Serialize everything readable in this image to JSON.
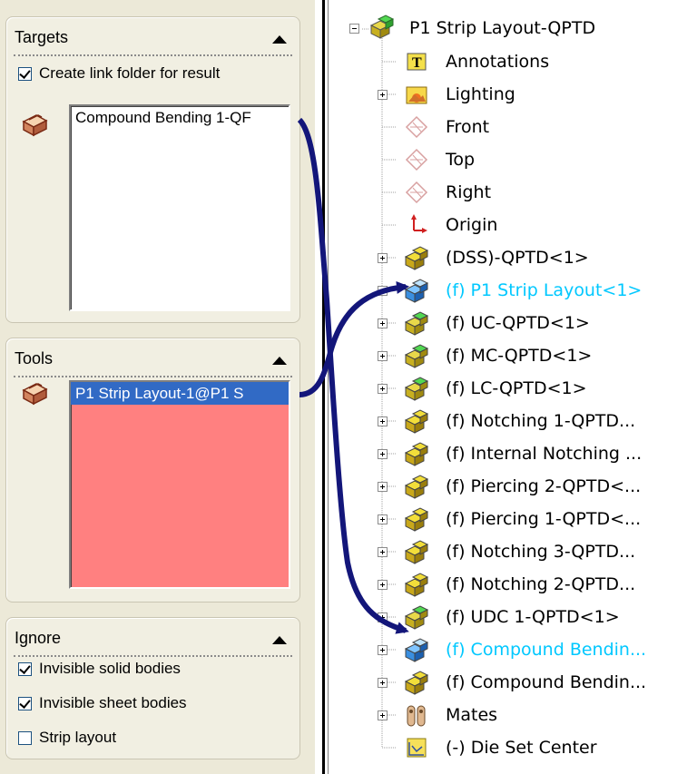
{
  "targets": {
    "title": "Targets",
    "create_link_label": "Create link folder for result",
    "create_link_checked": true,
    "items": [
      "Compound Bending 1-QF"
    ]
  },
  "tools": {
    "title": "Tools",
    "items": [
      "P1 Strip Layout-1@P1 S"
    ],
    "list_color": "#ff8080"
  },
  "ignore": {
    "title": "Ignore",
    "options": [
      {
        "label": "Invisible solid bodies",
        "checked": true
      },
      {
        "label": "Invisible sheet bodies",
        "checked": true
      },
      {
        "label": "Strip layout",
        "checked": false
      }
    ]
  },
  "tree": {
    "root": "P1 Strip Layout-QPTD",
    "nodes": [
      {
        "label": "Annotations",
        "icon": "annotations-icon",
        "expander": "none",
        "highlighted": false
      },
      {
        "label": "Lighting",
        "icon": "lighting-icon",
        "expander": "plus",
        "highlighted": false
      },
      {
        "label": "Front",
        "icon": "plane-icon",
        "expander": "none",
        "highlighted": false
      },
      {
        "label": "Top",
        "icon": "plane-icon",
        "expander": "none",
        "highlighted": false
      },
      {
        "label": "Right",
        "icon": "plane-icon",
        "expander": "none",
        "highlighted": false
      },
      {
        "label": "Origin",
        "icon": "origin-icon",
        "expander": "none",
        "highlighted": false
      },
      {
        "label": "(DSS)-QPTD<1>",
        "icon": "assembly-yellow-icon",
        "expander": "plus",
        "highlighted": false
      },
      {
        "label": "(f) P1 Strip Layout<1>",
        "icon": "assembly-blue-icon",
        "expander": "plus",
        "highlighted": true
      },
      {
        "label": "(f) UC-QPTD<1>",
        "icon": "assembly-green-icon",
        "expander": "plus",
        "highlighted": false
      },
      {
        "label": "(f) MC-QPTD<1>",
        "icon": "assembly-green-icon",
        "expander": "plus",
        "highlighted": false
      },
      {
        "label": "(f) LC-QPTD<1>",
        "icon": "assembly-green-icon",
        "expander": "plus",
        "highlighted": false
      },
      {
        "label": "(f) Notching 1-QPTD...",
        "icon": "assembly-yellow-icon",
        "expander": "plus",
        "highlighted": false
      },
      {
        "label": "(f) Internal Notching ...",
        "icon": "assembly-yellow-icon",
        "expander": "plus",
        "highlighted": false
      },
      {
        "label": "(f) Piercing 2-QPTD<...",
        "icon": "assembly-yellow-icon",
        "expander": "plus",
        "highlighted": false
      },
      {
        "label": "(f) Piercing 1-QPTD<...",
        "icon": "assembly-yellow-icon",
        "expander": "plus",
        "highlighted": false
      },
      {
        "label": "(f) Notching 3-QPTD...",
        "icon": "assembly-yellow-icon",
        "expander": "plus",
        "highlighted": false
      },
      {
        "label": "(f) Notching 2-QPTD...",
        "icon": "assembly-yellow-icon",
        "expander": "plus",
        "highlighted": false
      },
      {
        "label": "(f) UDC 1-QPTD<1>",
        "icon": "assembly-green-icon",
        "expander": "plus",
        "highlighted": false
      },
      {
        "label": "(f) Compound Bendin...",
        "icon": "assembly-blue-icon",
        "expander": "plus",
        "highlighted": true
      },
      {
        "label": "(f) Compound Bendin...",
        "icon": "assembly-yellow-icon",
        "expander": "plus",
        "highlighted": false
      },
      {
        "label": "Mates",
        "icon": "mates-icon",
        "expander": "plus",
        "highlighted": false
      },
      {
        "label": "(-) Die Set Center",
        "icon": "sketch-icon",
        "expander": "none",
        "highlighted": false
      }
    ]
  },
  "colors": {
    "highlight_text": "#00c8ff",
    "arrow": "#13167a",
    "selection": "#316ac5"
  }
}
